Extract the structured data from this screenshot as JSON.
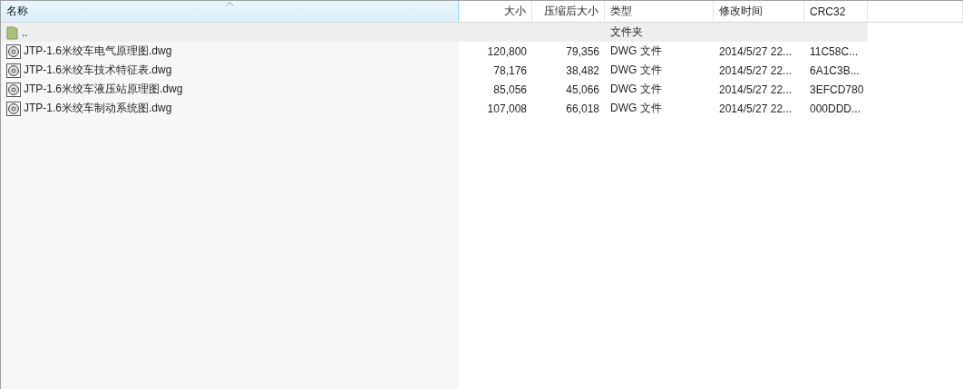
{
  "table": {
    "columns": [
      {
        "label": "名称",
        "selected": true
      },
      {
        "label": "大小",
        "selected": false
      },
      {
        "label": "压缩后大小",
        "selected": false
      },
      {
        "label": "类型",
        "selected": false
      },
      {
        "label": "修改时间",
        "selected": false
      },
      {
        "label": "CRC32",
        "selected": false
      }
    ],
    "rows": [
      {
        "kind": "folder",
        "selected": true,
        "cells": [
          "..",
          "",
          "",
          "文件夹",
          "",
          ""
        ]
      },
      {
        "kind": "file",
        "selected": false,
        "cells": [
          "JTP-1.6米绞车电气原理图.dwg",
          "120,800",
          "79,356",
          "DWG 文件",
          "2014/5/27 22...",
          "11C58C..."
        ]
      },
      {
        "kind": "file",
        "selected": false,
        "cells": [
          "JTP-1.6米绞车技术特征表.dwg",
          "78,176",
          "38,482",
          "DWG 文件",
          "2014/5/27 22...",
          "6A1C3B..."
        ]
      },
      {
        "kind": "file",
        "selected": false,
        "cells": [
          "JTP-1.6米绞车液压站原理图.dwg",
          "85,056",
          "45,066",
          "DWG 文件",
          "2014/5/27 22...",
          "3EFCD780"
        ]
      },
      {
        "kind": "file",
        "selected": false,
        "cells": [
          "JTP-1.6米绞车制动系统图.dwg",
          "107,008",
          "66,018",
          "DWG 文件",
          "2014/5/27 22...",
          "000DDD..."
        ]
      }
    ]
  }
}
